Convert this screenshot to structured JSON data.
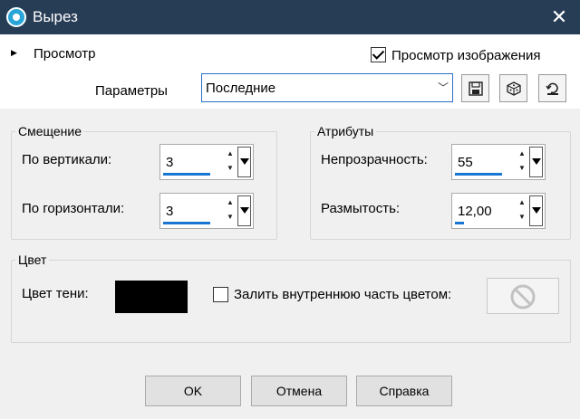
{
  "window": {
    "title": "Вырез",
    "close_icon": "close-icon",
    "app_icon": "cutout-app-icon"
  },
  "preview_section": {
    "label": "Просмотр",
    "expander_icon": "triangle-right-icon"
  },
  "image_preview": {
    "label": "Просмотр изображения",
    "checked": true
  },
  "presets": {
    "label": "Параметры",
    "selected": "Последние",
    "buttons": [
      {
        "name": "save-preset-button",
        "icon": "save-icon"
      },
      {
        "name": "random-preset-button",
        "icon": "dice-icon"
      },
      {
        "name": "reset-preset-button",
        "icon": "reset-icon"
      }
    ]
  },
  "offset": {
    "title": "Смещение",
    "vertical": {
      "label": "По вертикали:",
      "value": "3"
    },
    "horizontal": {
      "label": "По горизонтали:",
      "value": "3"
    }
  },
  "attributes": {
    "title": "Атрибуты",
    "opacity": {
      "label": "Непрозрачность:",
      "value": "55"
    },
    "blur": {
      "label": "Размытость:",
      "value": "12,00"
    }
  },
  "color": {
    "title": "Цвет",
    "shadow_label": "Цвет тени:",
    "shadow_color": "#000000",
    "fill_interior": {
      "label": "Залить внутреннюю часть цветом:",
      "checked": false
    },
    "fill_swatch_icon": "no-symbol-icon"
  },
  "buttons": {
    "ok": "OK",
    "cancel": "Отмена",
    "help": "Справка"
  },
  "colors": {
    "titlebar": "#273c55",
    "accent": "#1976d2"
  }
}
